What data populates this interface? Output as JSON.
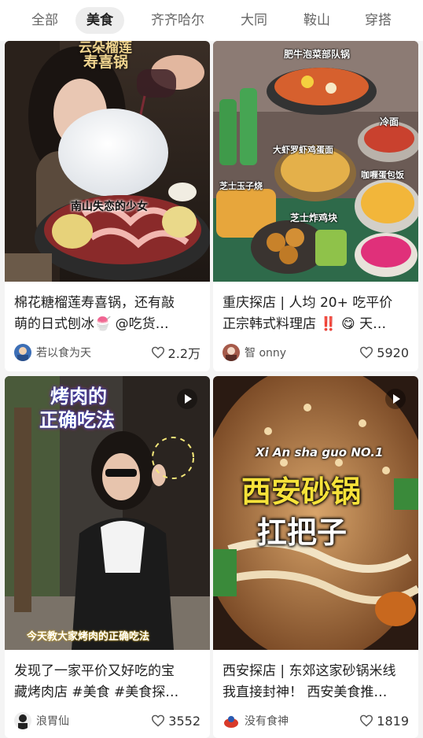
{
  "tabs": [
    {
      "label": "全部"
    },
    {
      "label": "美食"
    },
    {
      "label": "齐齐哈尔"
    },
    {
      "label": "大同"
    },
    {
      "label": "鞍山"
    },
    {
      "label": "穿搭"
    }
  ],
  "active_tab": "美食",
  "colors": {
    "accent_red": "#e0312f",
    "like_icon": "#555555",
    "background": "#f4f4f4"
  },
  "cards": [
    {
      "cover_text": [
        "云朵榴莲",
        "寿喜锅",
        "南山失恋的少女"
      ],
      "title_lines": [
        "棉花糖榴莲寿喜锅，还有敲",
        "萌的日式刨冰🍧 @吃货…"
      ],
      "author": "若以食为天",
      "likes": "2.2万",
      "icon": "heart-outline-icon",
      "is_video": false
    },
    {
      "cover_text": [
        "肥牛泡菜部队锅",
        "冷面",
        "芝士玉子烧",
        "大虾罗虾鸡蛋面",
        "咖喱蛋包饭",
        "芝士炸鸡块"
      ],
      "title_lines": [
        "重庆探店 | 人均 20+ 吃平价",
        "正宗韩式料理店 ‼️ 😋 天…"
      ],
      "author": "智 onny",
      "likes": "5920",
      "icon": "heart-outline-icon",
      "is_video": false
    },
    {
      "cover_text": [
        "烤肉的",
        "正确吃法",
        "今天教大家烤肉的正确吃法"
      ],
      "title_lines": [
        "发现了一家平价又好吃的宝",
        "藏烤肉店 #美食 #美食探…"
      ],
      "author": "浪胃仙",
      "likes": "3552",
      "icon": "heart-outline-icon",
      "is_video": true
    },
    {
      "cover_text": [
        "Xi An sha guo NO.1",
        "西安砂锅",
        "扛把子"
      ],
      "title_lines": [
        "西安探店 | 东郊这家砂锅米线",
        "我直接封神！ 西安美食推…"
      ],
      "author": "没有食神",
      "likes": "1819",
      "icon": "heart-outline-icon",
      "is_video": true
    }
  ]
}
